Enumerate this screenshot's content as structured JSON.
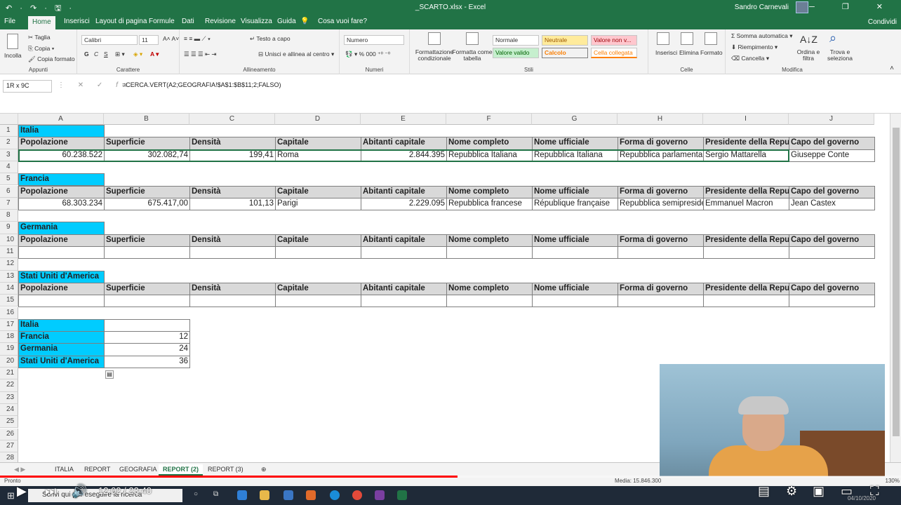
{
  "window": {
    "title": "_SCARTO.xlsx - Excel",
    "user": "Sandro Carnevali",
    "quick_access": "↶ · ↷ · 🖫 ·",
    "controls": "─ ❐ ✕"
  },
  "menu": {
    "tabs": [
      "File",
      "Home",
      "Inserisci",
      "Layout di pagina",
      "Formule",
      "Dati",
      "Revisione",
      "Visualizza",
      "Guida",
      "Cosa vuoi fare?"
    ],
    "share": "Condividi"
  },
  "ribbon": {
    "clipboard": {
      "paste": "Incolla",
      "cut": "Taglia",
      "copy": "Copia",
      "format_painter": "Copia formato",
      "label": "Appunti"
    },
    "font": {
      "name": "Calibri",
      "size": "11",
      "bold": "G",
      "italic": "C",
      "underline": "S",
      "label": "Carattere"
    },
    "alignment": {
      "wrap": "Testo a capo",
      "merge": "Unisci e allinea al centro",
      "label": "Allineamento"
    },
    "number": {
      "format": "Numero",
      "label": "Numeri",
      "percent": "% 000"
    },
    "styles": {
      "cond_format": "Formattazione condizionale",
      "format_table": "Formatta come tabella",
      "normale": "Normale",
      "neutrale": "Neutrale",
      "valore_non": "Valore non v...",
      "valore_valido": "Valore valido",
      "calcolo": "Calcolo",
      "cella_collegata": "Cella collegata",
      "label": "Stili"
    },
    "cells": {
      "insert": "Inserisci",
      "delete": "Elimina",
      "format": "Formato",
      "label": "Celle"
    },
    "editing": {
      "autosum": "Somma automatica",
      "fill": "Riempimento",
      "clear": "Cancella",
      "sort": "Ordina e filtra",
      "find": "Trova e seleziona",
      "label": "Modifica"
    }
  },
  "formula_bar": {
    "name_box": "1R x 9C",
    "fx": "fx",
    "formula": "=CERCA.VERT(A2;GEOGRAFIA!$A$1:$B$11;2;FALSO)"
  },
  "columns": [
    "A",
    "B",
    "C",
    "D",
    "E",
    "F",
    "G",
    "H",
    "I",
    "J"
  ],
  "rows": [
    "1",
    "2",
    "3",
    "4",
    "5",
    "6",
    "7",
    "8",
    "9",
    "10",
    "11",
    "12",
    "13",
    "14",
    "15",
    "16",
    "17",
    "18",
    "19",
    "20",
    "21",
    "22",
    "23",
    "24",
    "25",
    "26",
    "27",
    "28"
  ],
  "headers": [
    "Popolazione",
    "Superficie",
    "Densità",
    "Capitale",
    "Abitanti capitale",
    "Nome completo",
    "Nome ufficiale",
    "Forma di governo",
    "Presidente della Repubblica",
    "Capo del governo"
  ],
  "countries": {
    "italia": {
      "name": "Italia",
      "values": [
        "60.238.522",
        "302.082,74",
        "199,41",
        "Roma",
        "2.844.395",
        "Repubblica Italiana",
        "Repubblica Italiana",
        "Repubblica parlamentare",
        "Sergio Mattarella",
        "Giuseppe Conte"
      ]
    },
    "francia": {
      "name": "Francia",
      "values": [
        "68.303.234",
        "675.417,00",
        "101,13",
        "Parigi",
        "2.229.095",
        "Repubblica francese",
        "République française",
        "Repubblica semipresidenziale",
        "Emmanuel Macron",
        "Jean Castex"
      ]
    },
    "germania": {
      "name": "Germania"
    },
    "usa": {
      "name": "Stati Uniti d'America"
    }
  },
  "summary": [
    {
      "name": "Italia",
      "value": ""
    },
    {
      "name": "Francia",
      "value": "12"
    },
    {
      "name": "Germania",
      "value": "24"
    },
    {
      "name": "Stati Uniti d'America",
      "value": "36"
    }
  ],
  "sheets": [
    "ITALIA",
    "REPORT",
    "GEOGRAFIA",
    "REPORT (2)",
    "REPORT (3)"
  ],
  "active_sheet": "REPORT (2)",
  "status": {
    "ready": "Pronto",
    "media": "Media: 15.846.300",
    "zoom": "130%"
  },
  "taskbar": {
    "search_placeholder": "Scrivi qui per eseguire la ricerca",
    "date": "04/10/2020"
  },
  "video": {
    "current": "12:02",
    "duration": "23:40",
    "separator": "/",
    "progress_fraction": 0.508
  }
}
